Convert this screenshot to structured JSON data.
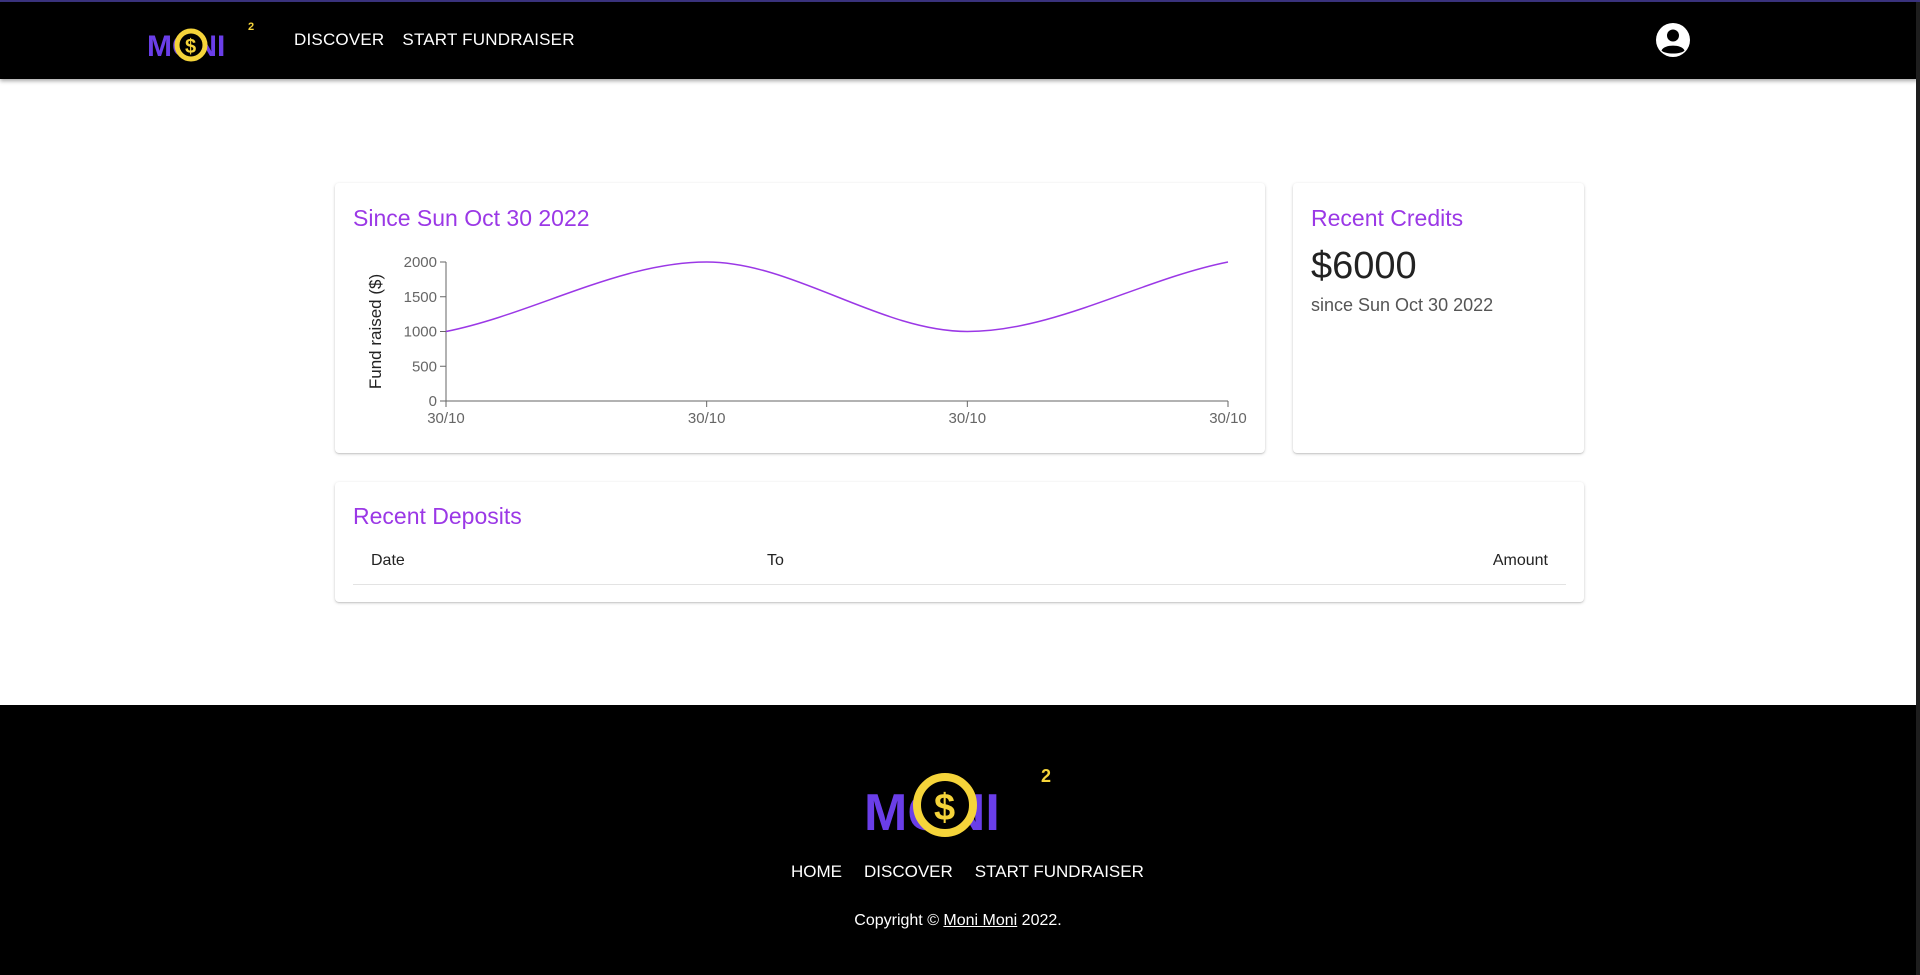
{
  "header": {
    "logo_text": "MONI",
    "logo_sup": "2",
    "nav": [
      {
        "label": "DISCOVER"
      },
      {
        "label": "START FUNDRAISER"
      }
    ],
    "account_icon": "account-circle-icon"
  },
  "chart_card": {
    "title": "Since Sun Oct 30 2022"
  },
  "credits_card": {
    "title": "Recent Credits",
    "amount": "$6000",
    "since": "since Sun Oct 30 2022"
  },
  "deposits_card": {
    "title": "Recent Deposits",
    "columns": [
      "Date",
      "To",
      "Amount"
    ]
  },
  "footer": {
    "logo_text": "MONI",
    "logo_sup": "2",
    "nav": [
      {
        "label": "HOME"
      },
      {
        "label": "DISCOVER"
      },
      {
        "label": "START FUNDRAISER"
      }
    ],
    "copyright_prefix": "Copyright © ",
    "copyright_link": "Moni Moni",
    "copyright_suffix": " 2022."
  },
  "colors": {
    "accent": "#9b38e6",
    "logo_purple": "#6a3ee8",
    "logo_gold": "#f5d43a",
    "header_bg": "#000000"
  },
  "chart_data": {
    "type": "line",
    "x": [
      "30/10",
      "30/10",
      "30/10",
      "30/10"
    ],
    "series": [
      {
        "values": [
          1000,
          2000,
          1000,
          2000
        ]
      }
    ],
    "ylabel": "Fund raised ($)",
    "xlabel": "",
    "ylim": [
      0,
      2000
    ],
    "yticks": [
      0,
      500,
      1000,
      1500,
      2000
    ],
    "line_color": "#9b38e6"
  }
}
